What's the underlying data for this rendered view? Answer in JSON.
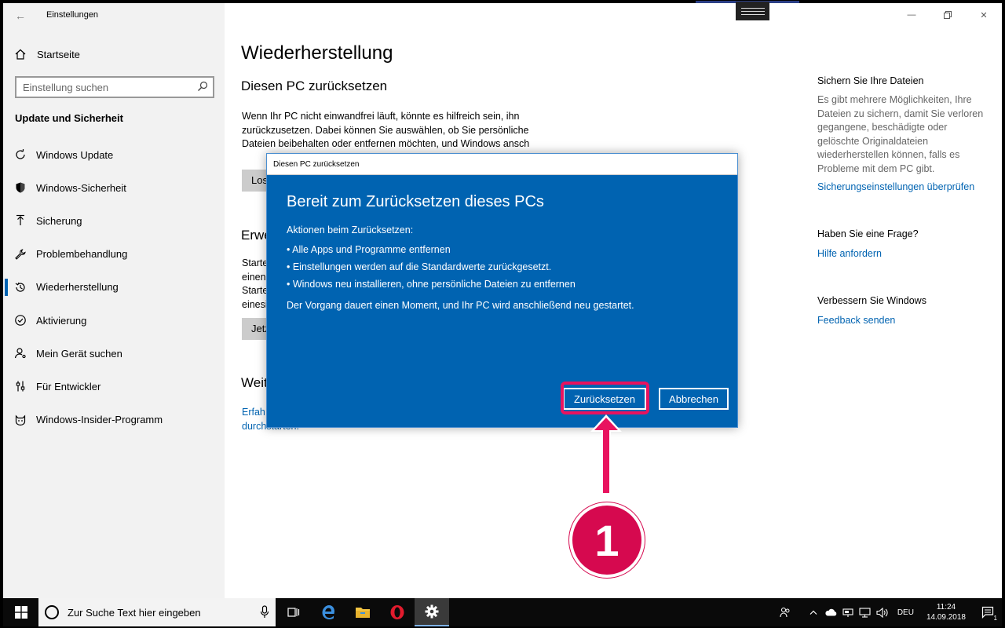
{
  "app": {
    "title": "Einstellungen"
  },
  "sidebar": {
    "home_label": "Startseite",
    "search_placeholder": "Einstellung suchen",
    "section_title": "Update und Sicherheit",
    "items": [
      {
        "label": "Windows Update",
        "icon": "refresh-icon"
      },
      {
        "label": "Windows-Sicherheit",
        "icon": "shield-icon"
      },
      {
        "label": "Sicherung",
        "icon": "upload-arrow-icon"
      },
      {
        "label": "Problembehandlung",
        "icon": "wrench-icon"
      },
      {
        "label": "Wiederherstellung",
        "icon": "history-icon",
        "active": true
      },
      {
        "label": "Aktivierung",
        "icon": "check-circle-icon"
      },
      {
        "label": "Mein Gerät suchen",
        "icon": "person-pin-icon"
      },
      {
        "label": "Für Entwickler",
        "icon": "sliders-icon"
      },
      {
        "label": "Windows-Insider-Programm",
        "icon": "cat-face-icon"
      }
    ]
  },
  "main": {
    "title": "Wiederherstellung",
    "reset_section": {
      "title": "Diesen PC zurücksetzen",
      "description": "Wenn Ihr PC nicht einwandfrei läuft, könnte es hilfreich sein, ihn zurückzusetzen. Dabei können Sie auswählen, ob Sie persönliche Dateien beibehalten oder entfernen möchten, und Windows ansch",
      "button_label": "Los"
    },
    "advanced_section": {
      "title": "Erwe",
      "description": "Starte einen Starte einesi",
      "button_label": "Jetz"
    },
    "more_section": {
      "title": "Weit",
      "link": "Erfah",
      "link2": "durchstarten."
    }
  },
  "right": {
    "backup_title": "Sichern Sie Ihre Dateien",
    "backup_text": "Es gibt mehrere Möglichkeiten, Ihre Dateien zu sichern, damit Sie verloren gegangene, beschädigte oder gelöschte Originaldateien wiederherstellen können, falls es Probleme mit dem PC gibt.",
    "backup_link": "Sicherungseinstellungen überprüfen",
    "question_title": "Haben Sie eine Frage?",
    "question_link": "Hilfe anfordern",
    "improve_title": "Verbessern Sie Windows",
    "improve_link": "Feedback senden"
  },
  "dialog": {
    "window_title": "Diesen PC zurücksetzen",
    "heading": "Bereit zum Zurücksetzen dieses PCs",
    "actions_label": "Aktionen beim Zurücksetzen:",
    "actions": [
      "• Alle Apps und Programme entfernen",
      "• Einstellungen werden auf die Standardwerte zurückgesetzt.",
      "• Windows neu installieren, ohne persönliche Dateien zu entfernen"
    ],
    "note": "Der Vorgang dauert einen Moment, und Ihr PC wird anschließend neu gestartet.",
    "primary_button": "Zurücksetzen",
    "secondary_button": "Abbrechen"
  },
  "annotation": {
    "step_number": "1",
    "color": "#d6094f"
  },
  "taskbar": {
    "search_placeholder": "Zur Suche Text hier eingeben",
    "language": "DEU",
    "time": "11:24",
    "date": "14.09.2018",
    "notification_count": "1"
  },
  "colors": {
    "accent": "#0063b1",
    "highlight": "#e8135f",
    "sidebar_bg": "#f2f2f2"
  }
}
